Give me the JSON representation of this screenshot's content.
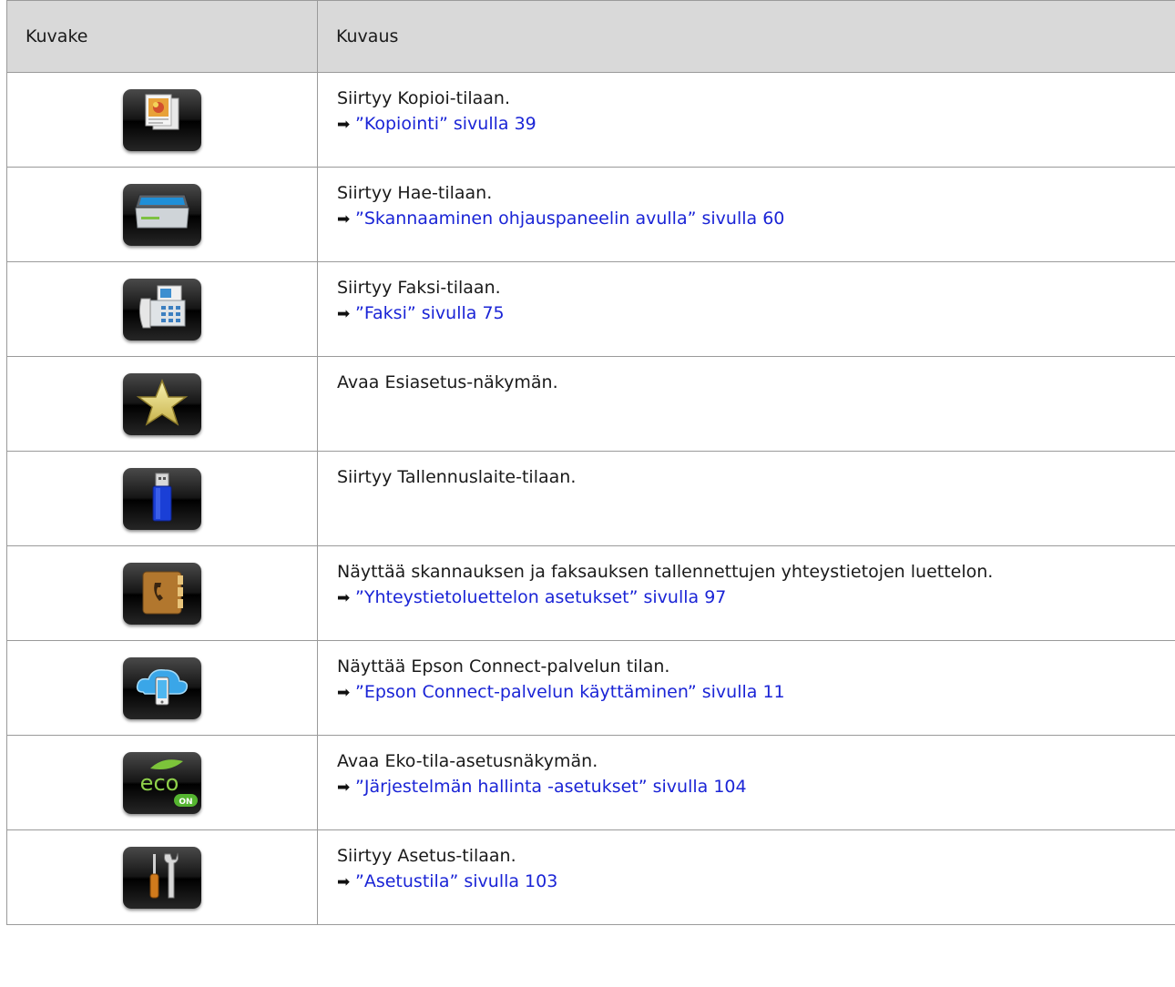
{
  "header": {
    "col_icon": "Kuvake",
    "col_desc": "Kuvaus"
  },
  "rows": [
    {
      "icon": "copy-icon",
      "desc": "Siirtyy Kopioi-tilaan.",
      "link": "”Kopiointi” sivulla 39"
    },
    {
      "icon": "scan-icon",
      "desc": "Siirtyy Hae-tilaan.",
      "link": "”Skannaaminen ohjauspaneelin avulla” sivulla 60"
    },
    {
      "icon": "fax-icon",
      "desc": "Siirtyy Faksi-tilaan.",
      "link": "”Faksi” sivulla 75"
    },
    {
      "icon": "star-icon",
      "desc": "Avaa Esiasetus-näkymän."
    },
    {
      "icon": "usb-storage-icon",
      "desc": "Siirtyy Tallennuslaite-tilaan."
    },
    {
      "icon": "contacts-icon",
      "desc": "Näyttää skannauksen ja faksauksen tallennettujen yhteystietojen luettelon.",
      "link": "”Yhteystietoluettelon asetukset” sivulla 97"
    },
    {
      "icon": "epson-connect-icon",
      "desc": "Näyttää Epson Connect-palvelun tilan.",
      "link": "”Epson Connect-palvelun käyttäminen” sivulla 11"
    },
    {
      "icon": "eco-icon",
      "desc": "Avaa Eko-tila-asetusnäkymän.",
      "link": "”Järjestelmän hallinta -asetukset” sivulla 104"
    },
    {
      "icon": "setup-tools-icon",
      "desc": "Siirtyy Asetus-tilaan.",
      "link": "”Asetustila” sivulla 103"
    }
  ],
  "eco_icon_text": {
    "word": "eco",
    "badge": "ON"
  },
  "colors": {
    "link": "#1a24d6",
    "header_bg": "#d9d9d9",
    "border": "#9a9a9a"
  }
}
